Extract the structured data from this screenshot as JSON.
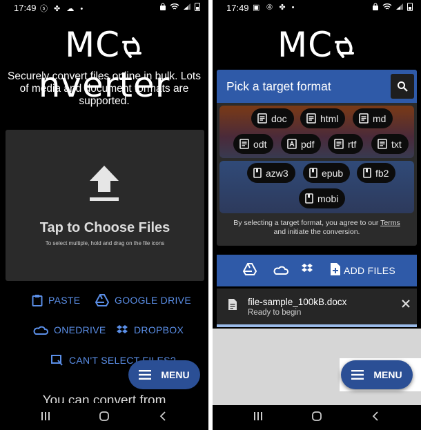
{
  "left": {
    "status_time": "17:49",
    "logo_prefix": "MC",
    "logo_suffix": "nverter",
    "tagline": "Securely convert files online in bulk. Lots of media and document formats are supported.",
    "dropzone_title": "Tap to Choose Files",
    "dropzone_hint": "To select multiple, hold and drag on the file icons",
    "paste": "PASTE",
    "google_drive": "GOOGLE DRIVE",
    "onedrive": "ONEDRIVE",
    "dropbox": "DROPBOX",
    "cant_select": "CAN'T SELECT FILES?",
    "cut_text": "You can convert from",
    "menu": "MENU"
  },
  "right": {
    "status_time": "17:49",
    "logo_prefix": "MC",
    "logo_suffix": "nverter",
    "picker_title": "Pick a target format",
    "formats_doc": [
      "doc",
      "html",
      "md",
      "odt",
      "pdf",
      "rtf",
      "txt"
    ],
    "formats_ebook": [
      "azw3",
      "epub",
      "fb2",
      "mobi"
    ],
    "agree_before": "By selecting a target format, you agree to our ",
    "agree_terms": "Terms",
    "agree_after": "and initiate the conversion.",
    "add_files": "ADD FILES",
    "file_name": "file-sample_100kB.docx",
    "file_status": "Ready to begin",
    "menu": "MENU"
  },
  "colors": {
    "accent_blue": "#2f5aa8",
    "link_blue": "#5b8fe8",
    "fab_blue": "#2b4f95"
  },
  "icons": [
    "search-icon",
    "document-icon",
    "pdf-icon",
    "book-icon",
    "google-drive-icon",
    "onedrive-icon",
    "dropbox-icon",
    "clipboard-icon",
    "add-file-icon",
    "close-icon",
    "menu-icon",
    "upload-icon"
  ]
}
